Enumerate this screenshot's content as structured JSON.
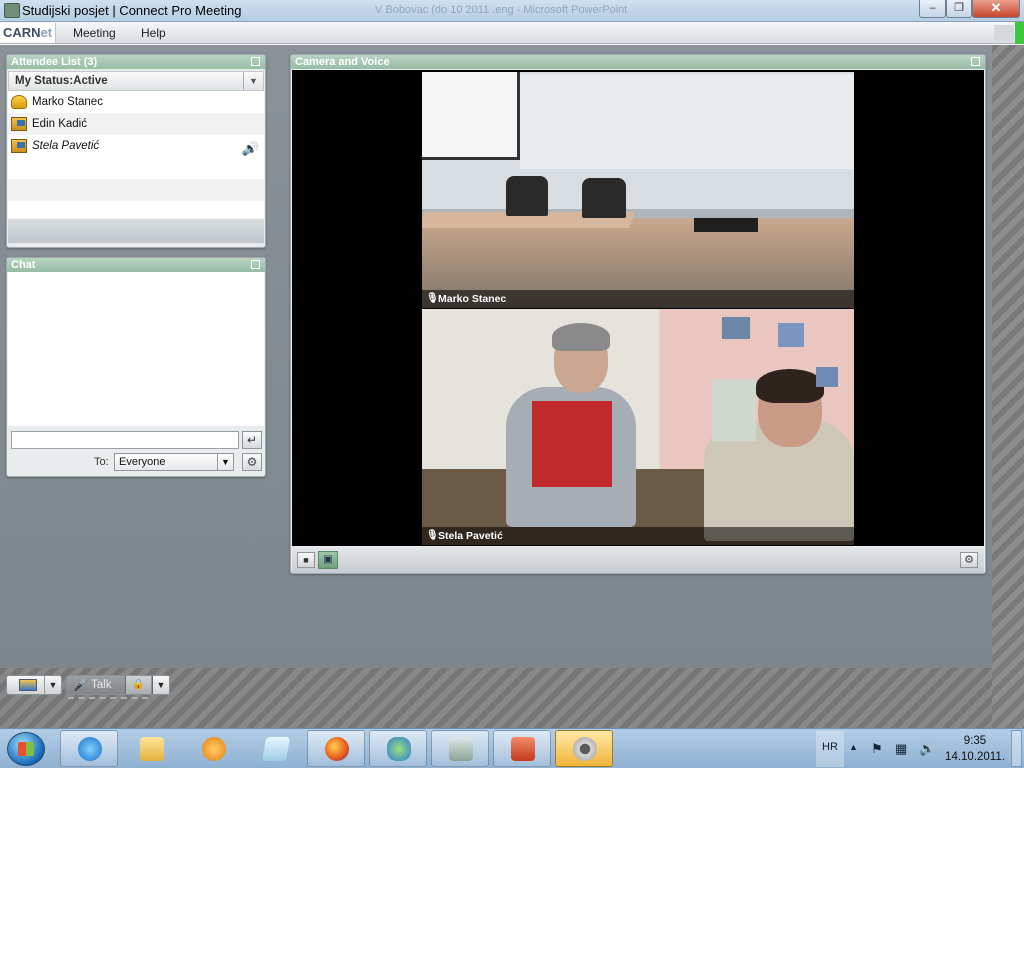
{
  "window": {
    "title": "Studijski posjet | Connect Pro Meeting",
    "ghost_title": "V Bobovac (do 10 2011 .eng - Microsoft PowerPoint",
    "min": "‒",
    "max": "❐",
    "close": "✕"
  },
  "menubar": {
    "logo_main": "CARN",
    "logo_accent": "et",
    "items": [
      "Meeting",
      "Help"
    ]
  },
  "attendee_pod": {
    "title": "Attendee List (3)",
    "status": "My Status:Active",
    "attendees": [
      {
        "name": "Marko Stanec",
        "role": "host"
      },
      {
        "name": "Edin Kadić",
        "role": "participant"
      },
      {
        "name": "Stela Pavetić",
        "role": "participant",
        "speaking": true
      }
    ]
  },
  "chat_pod": {
    "title": "Chat",
    "input_value": "",
    "to_label": "To:",
    "recipient": "Everyone"
  },
  "camera_pod": {
    "title": "Camera and Voice",
    "videos": [
      {
        "name": "Marko Stanec"
      },
      {
        "name": "Stela Pavetić"
      }
    ]
  },
  "bottom_bar": {
    "talk_label": "Talk"
  },
  "taskbar": {
    "apps": [
      "internet-explorer",
      "windows-explorer",
      "media-player",
      "notepad",
      "firefox",
      "live-messenger",
      "connect-addin",
      "powerpoint",
      "webcam"
    ],
    "language": "HR",
    "time": "9:35",
    "date": "14.10.2011."
  }
}
